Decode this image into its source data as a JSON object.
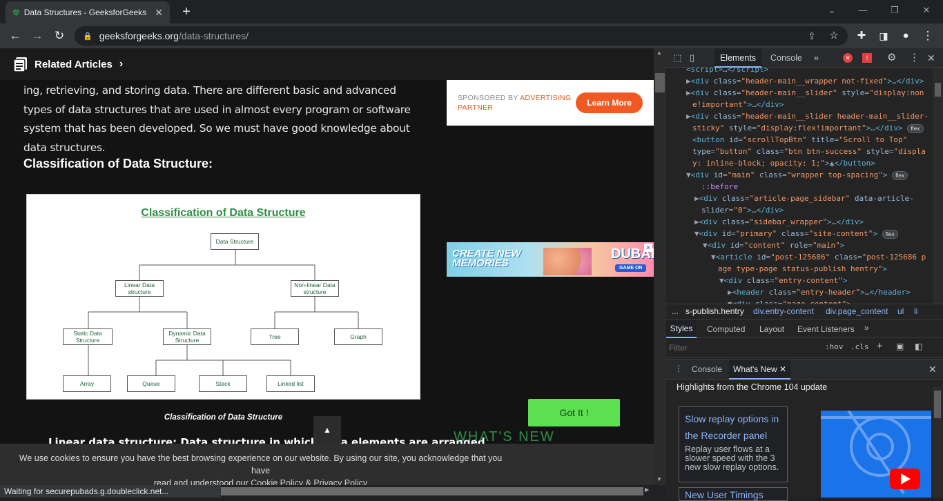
{
  "browser": {
    "tab_title": "Data Structures - GeeksforGeeks",
    "url_domain": "geeksforgeeks.org",
    "url_path": "/data-structures/",
    "status_text": "Waiting for securepubads.g.doubleclick.net..."
  },
  "page": {
    "related_label": "Related Articles",
    "paragraph": "ing, retrieving, and storing data. There are different basic and advanced types of data structures that are used in almost every program or software system that has been developed. So we must have good knowledge about data structures.",
    "heading": "Classification of Data Structure:",
    "diagram": {
      "title": "Classification of Data Structure",
      "nodes": {
        "root": "Data Structure",
        "linear": "Linear Data structure",
        "nonlinear": "Non-linear Data structure",
        "static": "Static Data Structure",
        "dynamic": "Dynamic Data Structure",
        "tree": "Tree",
        "graph": "Graph",
        "array": "Array",
        "queue": "Queue",
        "stack": "Stack",
        "linkedlist": "Linked list"
      }
    },
    "caption": "Classification of Data Structure",
    "partial_text": "Linear data structure: Data structure in which data elements are arranged",
    "sponsor": {
      "prefix": "SPONSORED BY",
      "adv": "ADVERTISING",
      "partner": "PARTNER",
      "button": "Learn More"
    },
    "ad": {
      "line1": "CREATE NEW",
      "line2": "MEMORIES",
      "logo": "DUBAI",
      "cta": "GAME ON"
    },
    "whats_new": "WHAT'S NEW",
    "cookie": {
      "msg1": "We use cookies to ensure you have the best browsing experience on our website. By using our site, you acknowledge that you have",
      "msg2": "read and understood our",
      "policy": "Cookie Policy",
      "amp": "&",
      "privacy": "Privacy Policy",
      "button": "Got It !"
    }
  },
  "devtools": {
    "tabs": [
      "Elements",
      "Console"
    ],
    "breadcrumbs": [
      "...",
      "s-publish.hentry",
      "div.entry-content",
      "div.page_content",
      "ul",
      "li"
    ],
    "styles_tabs": [
      "Styles",
      "Computed",
      "Layout",
      "Event Listeners"
    ],
    "filter_placeholder": "Filter",
    "hov": ":hov",
    "cls": ".cls",
    "drawer_tabs": [
      "Console",
      "What's New"
    ],
    "highlights": "Highlights from the Chrome 104 update",
    "card_title": "Slow replay options in the Recorder panel",
    "card_desc": "Replay user flows at a slower speed with the 3 new slow replay options.",
    "card2_title": "New User Timings"
  }
}
